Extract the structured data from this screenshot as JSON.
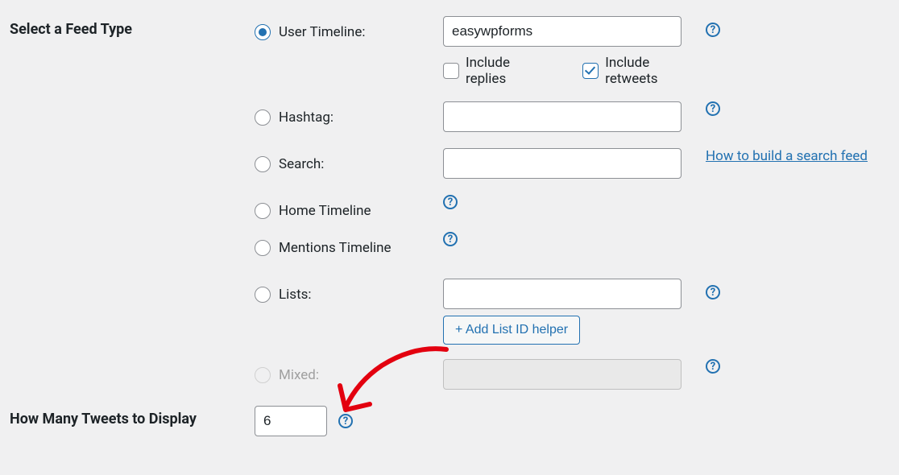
{
  "feed_type": {
    "section_label": "Select a Feed Type",
    "selected": "user_timeline",
    "options": {
      "user_timeline": {
        "label": "User Timeline:",
        "value": "easywpforms",
        "include_replies": {
          "label": "Include replies",
          "checked": false
        },
        "include_retweets": {
          "label": "Include retweets",
          "checked": true
        }
      },
      "hashtag": {
        "label": "Hashtag:",
        "value": ""
      },
      "search": {
        "label": "Search:",
        "value": "",
        "help_link": "How to build a search feed"
      },
      "home_timeline": {
        "label": "Home Timeline"
      },
      "mentions_timeline": {
        "label": "Mentions Timeline"
      },
      "lists": {
        "label": "Lists:",
        "value": "",
        "helper_button": "+ Add List ID helper"
      },
      "mixed": {
        "label": "Mixed:",
        "value": "",
        "disabled": true
      }
    }
  },
  "tweet_count": {
    "section_label": "How Many Tweets to Display",
    "value": "6"
  }
}
